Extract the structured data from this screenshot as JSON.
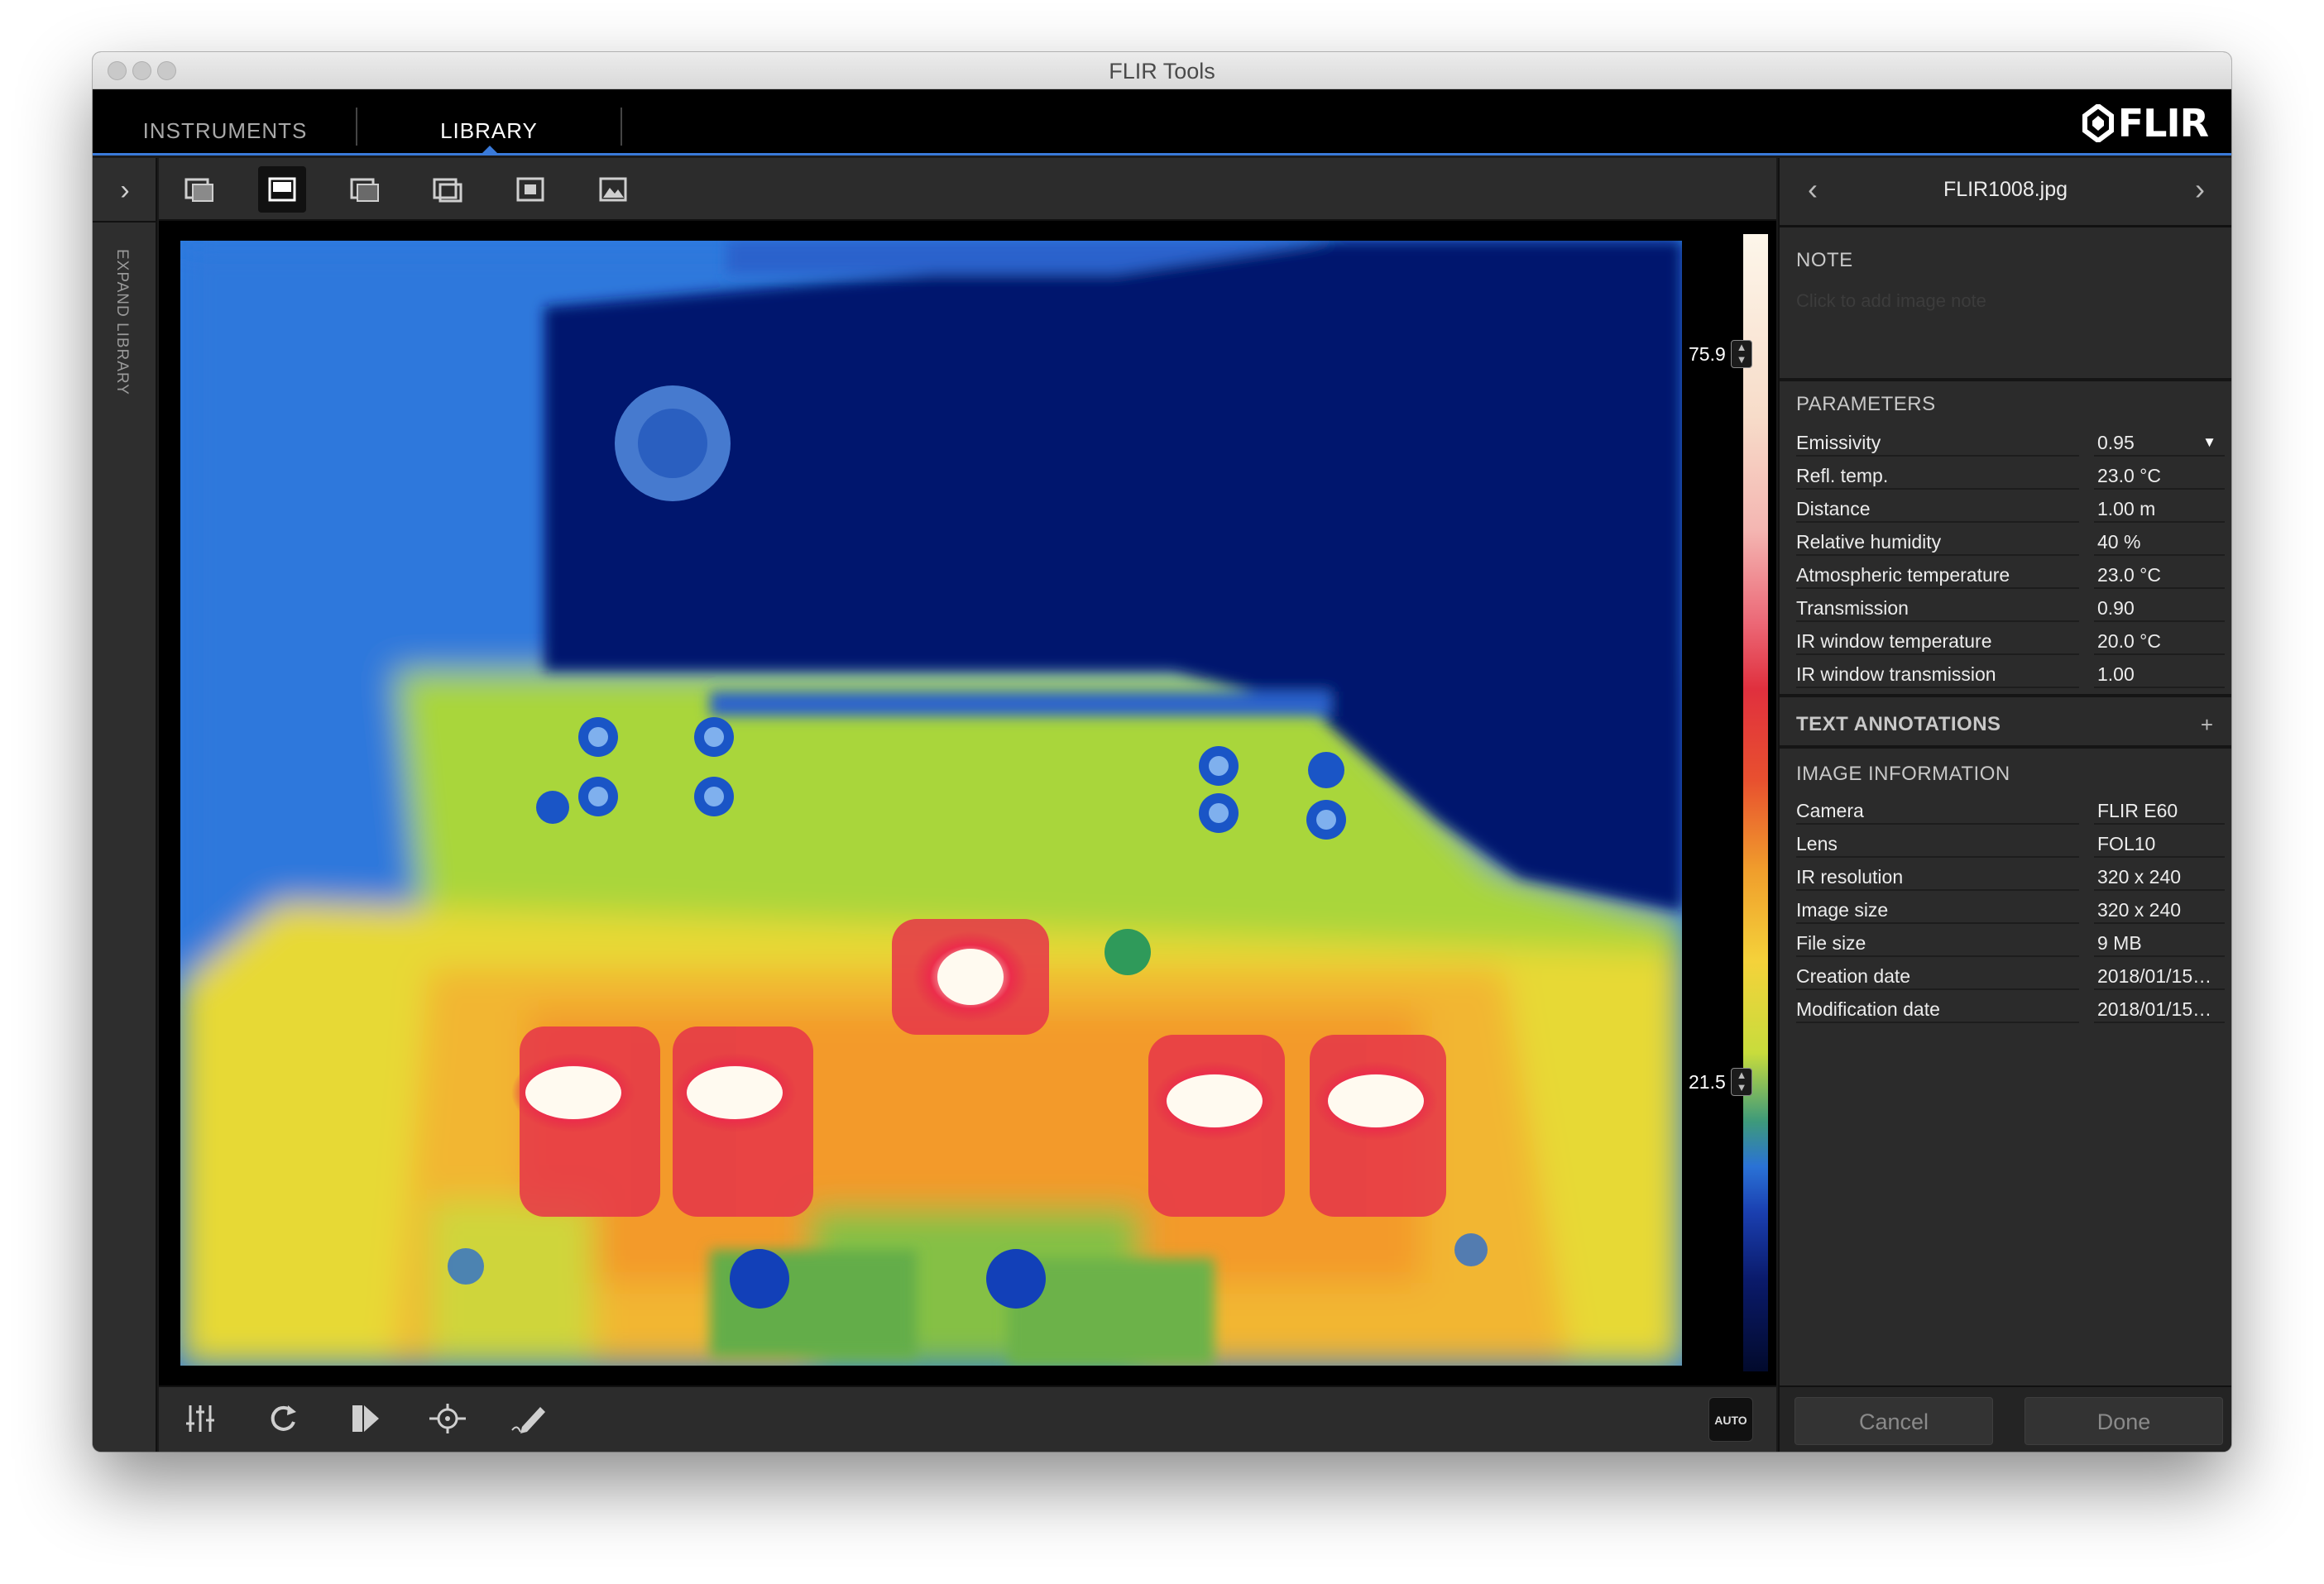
{
  "window": {
    "title": "FLIR Tools"
  },
  "tabs": [
    {
      "label": "INSTRUMENTS"
    },
    {
      "label": "LIBRARY"
    }
  ],
  "logo": {
    "text": "FLIR"
  },
  "left_strip": {
    "expand_label": "EXPAND LIBRARY"
  },
  "view_modes": [
    "picture-in-picture-mode-icon",
    "thermal-only-mode-icon",
    "blending-mode-icon",
    "msx-mode-icon",
    "thermal-frame-mode-icon",
    "visual-photo-mode-icon"
  ],
  "scale": {
    "max": "75.9",
    "min": "21.5"
  },
  "bottom_tools": [
    "adjustments-icon",
    "rotate-icon",
    "palette-icon",
    "measurement-icon",
    "annotate-pen-icon"
  ],
  "auto_button": "AUTO",
  "sidebar": {
    "filename": "FLIR1008.jpg",
    "note": {
      "title": "NOTE",
      "placeholder": "Click to add image note"
    },
    "parameters": {
      "title": "PARAMETERS",
      "rows": [
        {
          "label": "Emissivity",
          "value": "0.95"
        },
        {
          "label": "Refl. temp.",
          "value": "23.0 °C"
        },
        {
          "label": "Distance",
          "value": "1.00 m"
        },
        {
          "label": "Relative humidity",
          "value": "40 %"
        },
        {
          "label": "Atmospheric temperature",
          "value": "23.0 °C"
        },
        {
          "label": "Transmission",
          "value": "0.90"
        },
        {
          "label": "IR window temperature",
          "value": "20.0 °C"
        },
        {
          "label": "IR window transmission",
          "value": "1.00"
        }
      ]
    },
    "text_annotations": {
      "title": "TEXT ANNOTATIONS",
      "add": "+"
    },
    "image_information": {
      "title": "IMAGE INFORMATION",
      "rows": [
        {
          "label": "Camera",
          "value": "FLIR E60"
        },
        {
          "label": "Lens",
          "value": "FOL10"
        },
        {
          "label": "IR resolution",
          "value": "320 x 240"
        },
        {
          "label": "Image size",
          "value": "320 x 240"
        },
        {
          "label": "File size",
          "value": "9 MB"
        },
        {
          "label": "Creation date",
          "value": "2018/01/15…"
        },
        {
          "label": "Modification date",
          "value": "2018/01/15…"
        }
      ]
    },
    "buttons": {
      "cancel": "Cancel",
      "done": "Done"
    }
  },
  "colors": {
    "accent": "#3a7ad9",
    "background": "#2b2b2b"
  }
}
